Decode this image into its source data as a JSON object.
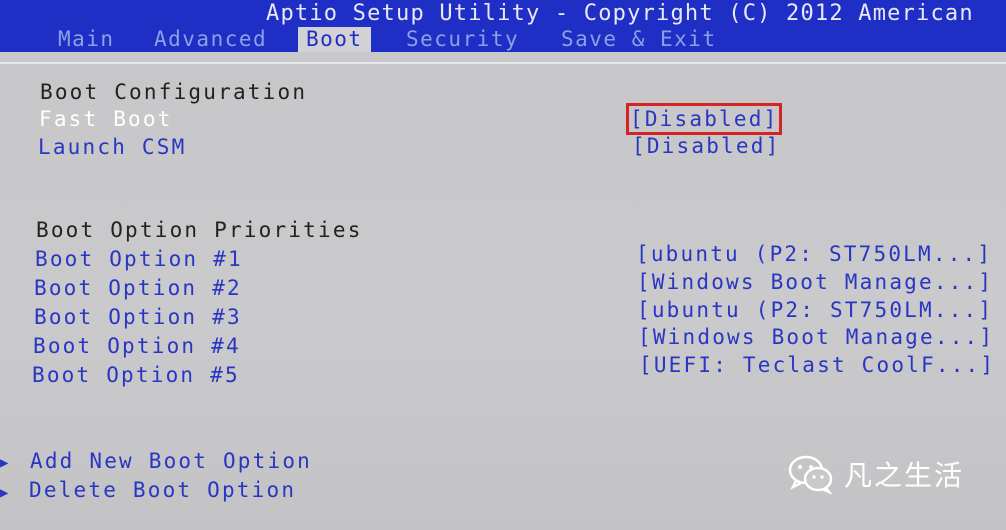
{
  "title": "Aptio Setup Utility - Copyright (C) 2012 American",
  "tabs": [
    "Main",
    "Advanced",
    "Boot",
    "Security",
    "Save & Exit"
  ],
  "active_tab": "Boot",
  "boot_config": {
    "heading": "Boot Configuration",
    "fast_boot": {
      "label": "Fast Boot",
      "value": "[Disabled]"
    },
    "launch_csm": {
      "label": "Launch CSM",
      "value": "[Disabled]"
    }
  },
  "priorities": {
    "heading": "Boot Option Priorities",
    "options": [
      {
        "label": "Boot Option #1",
        "value": "[ubuntu (P2: ST750LM...]"
      },
      {
        "label": "Boot Option #2",
        "value": "[Windows Boot Manage...]"
      },
      {
        "label": "Boot Option #3",
        "value": "[ubuntu (P2: ST750LM...]"
      },
      {
        "label": "Boot Option #4",
        "value": "[Windows Boot Manage...]"
      },
      {
        "label": "Boot Option #5",
        "value": "[UEFI: Teclast CoolF...]"
      }
    ]
  },
  "actions": {
    "add": "Add New Boot Option",
    "delete": "Delete Boot Option"
  },
  "watermark": "凡之生活",
  "colors": {
    "header_bg": "#1f2fc6",
    "body_bg": "#c9c9cb",
    "label_blue": "#2836c2",
    "highlight_box": "#d42424"
  }
}
